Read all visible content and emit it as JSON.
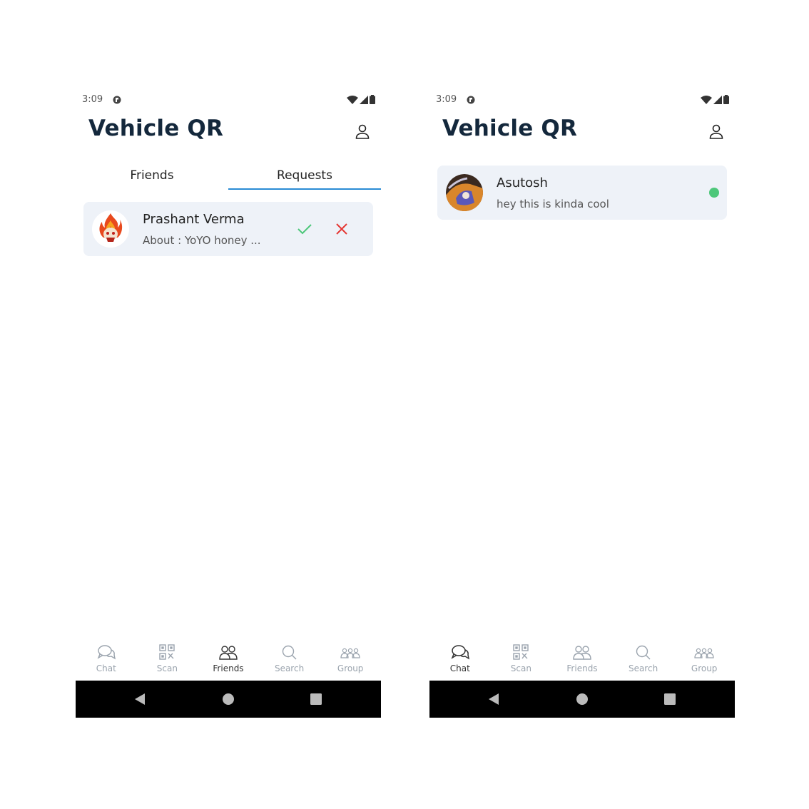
{
  "colors": {
    "accent": "#2a8bd4",
    "title": "#14283c",
    "card_bg": "#eef2f8",
    "accept": "#4dc77a",
    "reject": "#e53935",
    "online": "#4dc77a"
  },
  "left_screen": {
    "status": {
      "time": "3:09"
    },
    "app_title": "Vehicle QR",
    "tabs": [
      {
        "label": "Friends",
        "active": false
      },
      {
        "label": "Requests",
        "active": true
      }
    ],
    "request": {
      "name": "Prashant Verma",
      "about": "About : YoYO honey ..."
    },
    "nav": {
      "items": [
        {
          "label": "Chat",
          "icon": "chat-icon",
          "active": false
        },
        {
          "label": "Scan",
          "icon": "qr-icon",
          "active": false
        },
        {
          "label": "Friends",
          "icon": "friends-icon",
          "active": true
        },
        {
          "label": "Search",
          "icon": "search-icon",
          "active": false
        },
        {
          "label": "Group",
          "icon": "group-icon",
          "active": false
        }
      ]
    }
  },
  "right_screen": {
    "status": {
      "time": "3:09"
    },
    "app_title": "Vehicle QR",
    "chat": {
      "name": "Asutosh",
      "last_message": "hey this is kinda cool",
      "online": true
    },
    "nav": {
      "items": [
        {
          "label": "Chat",
          "icon": "chat-icon",
          "active": true
        },
        {
          "label": "Scan",
          "icon": "qr-icon",
          "active": false
        },
        {
          "label": "Friends",
          "icon": "friends-icon",
          "active": false
        },
        {
          "label": "Search",
          "icon": "search-icon",
          "active": false
        },
        {
          "label": "Group",
          "icon": "group-icon",
          "active": false
        }
      ]
    }
  }
}
